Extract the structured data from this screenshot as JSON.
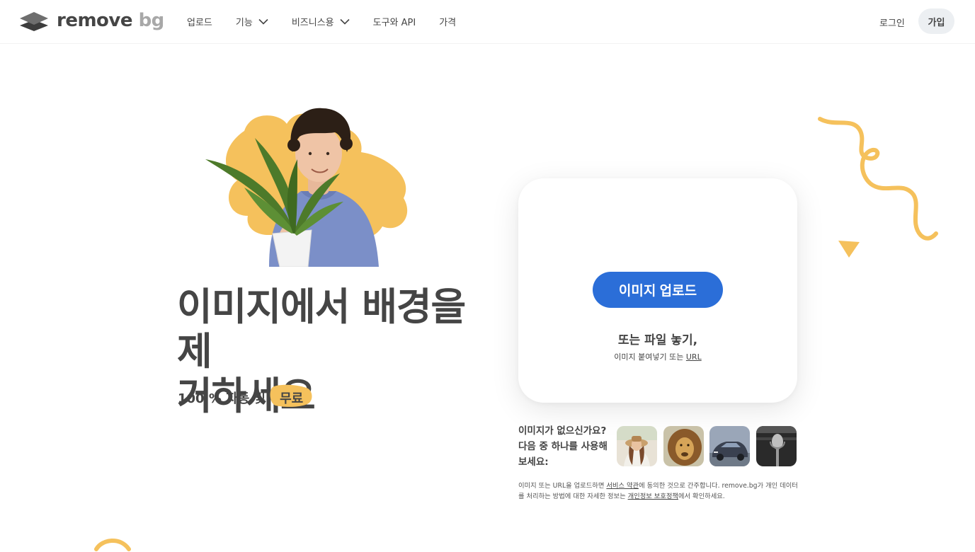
{
  "header": {
    "logo_main": "remove",
    "logo_accent": "bg",
    "nav": [
      {
        "label": "업로드"
      },
      {
        "label": "기능"
      },
      {
        "label": "비즈니스용"
      },
      {
        "label": "도구와 API"
      },
      {
        "label": "가격"
      }
    ],
    "login_label": "로그인",
    "signup_label": "가입"
  },
  "hero": {
    "headline_line1": "이미지에서 배경을 제",
    "headline_line2": "거하세요",
    "sub_text": "100 % 자동 및",
    "sub_badge": "무료"
  },
  "upload": {
    "button_label": "이미지 업로드",
    "drop_text": "또는 파일 놓기,",
    "paste_text": "이미지 붙여넣기 또는",
    "url_link": "URL"
  },
  "samples": {
    "question": "이미지가 없으신가요? 다음 중 하나를 사용해 보세요:",
    "items": [
      {
        "icon": "woman-photo"
      },
      {
        "icon": "lion-photo"
      },
      {
        "icon": "car-photo"
      },
      {
        "icon": "microphone-photo"
      }
    ]
  },
  "terms": {
    "part1": "이미지 또는 URL을 업로드하면 ",
    "link1": "서비스 약관",
    "part2": "에 동의한 것으로 간주합니다. remove.bg가 개인 데이터를 처리하는 방법에 대한 자세한 정보는 ",
    "link2": "개인정보 보호정책",
    "part3": "에서 확인하세요."
  },
  "colors": {
    "accent_blue": "#2b6ed8",
    "accent_yellow": "#f5c15c",
    "text": "#454545"
  }
}
